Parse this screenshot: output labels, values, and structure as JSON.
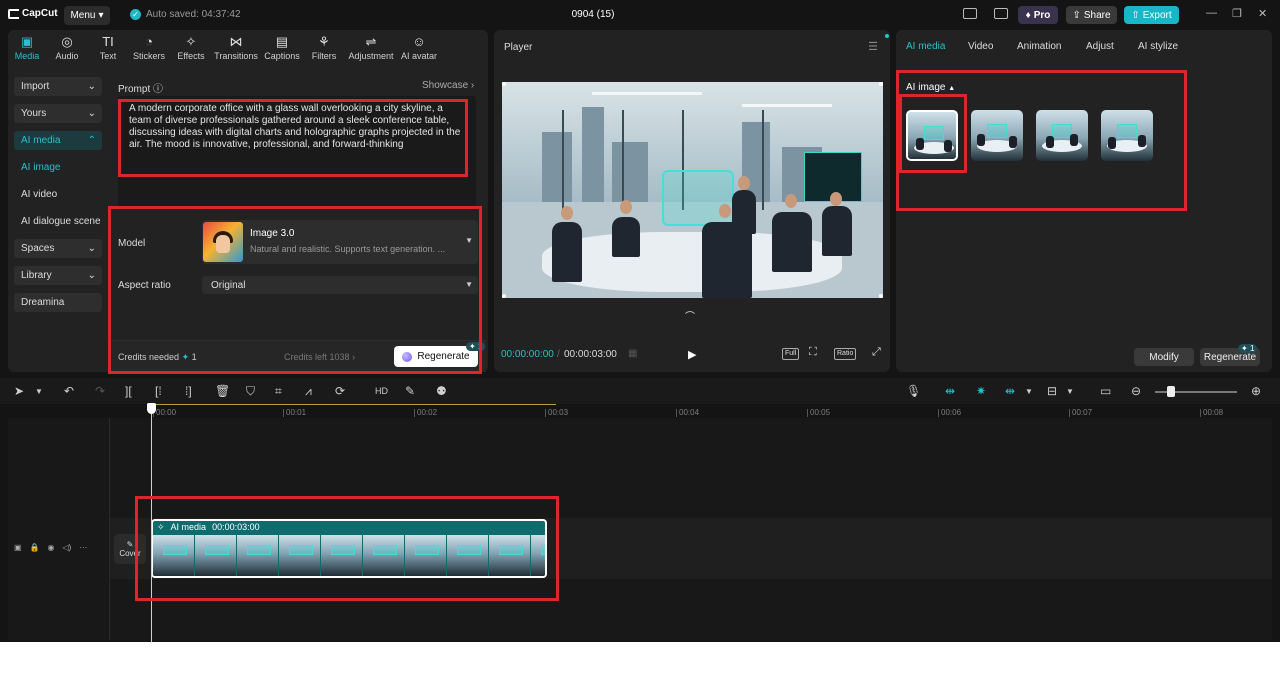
{
  "app": {
    "logo": "CapCut",
    "menu_label": "Menu",
    "autosave": "Auto saved: 04:37:42",
    "title": "0904 (15)",
    "pro_label": "Pro",
    "share_label": "Share",
    "export_label": "Export"
  },
  "tools": [
    {
      "label": "Media",
      "icon": "▣"
    },
    {
      "label": "Audio",
      "icon": "◎"
    },
    {
      "label": "Text",
      "icon": "TI"
    },
    {
      "label": "Stickers",
      "icon": "◔"
    },
    {
      "label": "Effects",
      "icon": "✧"
    },
    {
      "label": "Transitions",
      "icon": "⋈"
    },
    {
      "label": "Captions",
      "icon": "▤"
    },
    {
      "label": "Filters",
      "icon": "⚘"
    },
    {
      "label": "Adjustment",
      "icon": "⇌"
    },
    {
      "label": "AI avatar",
      "icon": "☺"
    }
  ],
  "sidebar": {
    "import": "Import",
    "yours": "Yours",
    "ai_media": "AI media",
    "ai_image": "AI image",
    "ai_video": "AI video",
    "ai_dialogue": "AI dialogue scene",
    "spaces": "Spaces",
    "library": "Library",
    "dreamina": "Dreamina"
  },
  "prompt": {
    "label": "Prompt",
    "showcase": "Showcase",
    "text": "A modern corporate office with a glass wall overlooking a city skyline, a team of diverse professionals gathered around a sleek conference table, discussing ideas with digital charts and holographic graphs projected in the air. The mood is innovative, professional, and forward-thinking"
  },
  "model": {
    "label": "Model",
    "name": "Image 3.0",
    "description": "Natural and realistic. Supports text generation. ..."
  },
  "aspect": {
    "label": "Aspect ratio",
    "value": "Original"
  },
  "credits": {
    "needed_label": "Credits needed",
    "needed_value": "1",
    "left": "Credits left 1038",
    "regenerate": "Regenerate",
    "badge": "1"
  },
  "player": {
    "title": "Player",
    "current": "00:00:00:00",
    "total": "00:00:03:00",
    "full": "Full",
    "ratio": "Ratio"
  },
  "right": {
    "tabs": [
      "AI media",
      "Video",
      "Animation",
      "Adjust",
      "AI stylize"
    ],
    "ai_image_label": "AI image",
    "modify": "Modify",
    "regenerate": "Regenerate",
    "badge": "1"
  },
  "timeline": {
    "ticks": [
      "00:00",
      "00:01",
      "00:02",
      "00:03",
      "00:04",
      "00:05",
      "00:06",
      "00:07",
      "00:08"
    ],
    "clip_label": "AI media",
    "clip_duration": "00:00:03:00",
    "cover": "Cover"
  },
  "colors": {
    "accent": "#25c0cf",
    "highlight_box": "#e0242b"
  }
}
